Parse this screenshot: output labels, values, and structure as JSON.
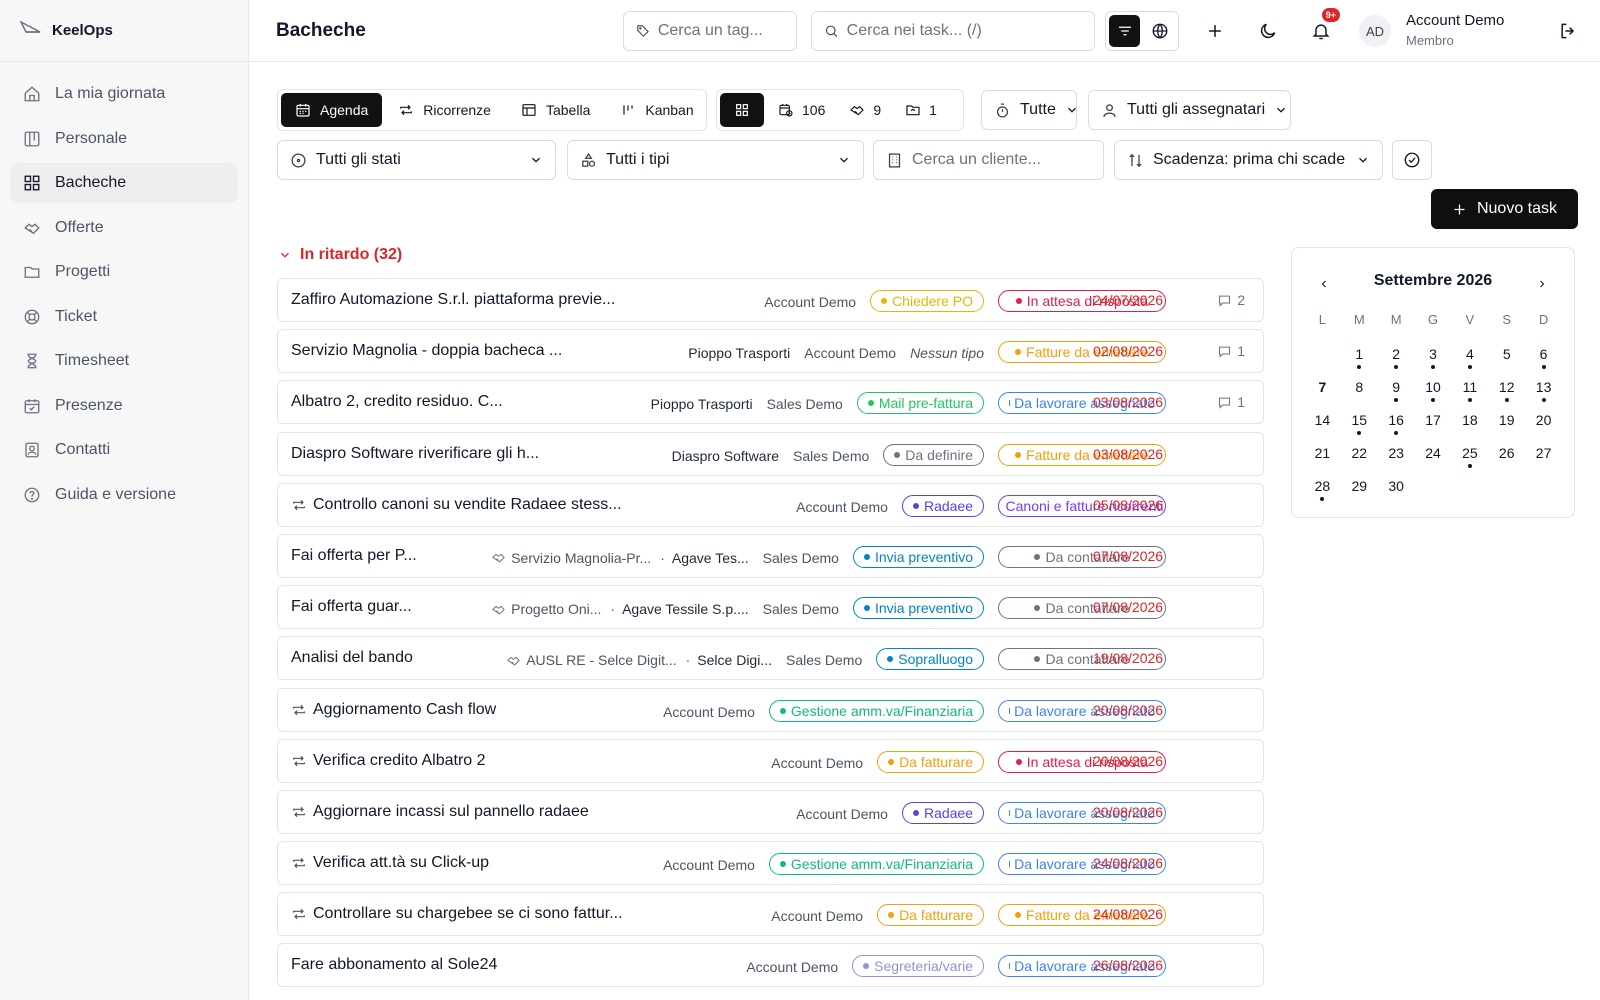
{
  "app": {
    "name": "KeelOps"
  },
  "sidebar": {
    "items": [
      {
        "label": "La mia giornata",
        "icon": "home-icon"
      },
      {
        "label": "Personale",
        "icon": "board-icon"
      },
      {
        "label": "Bacheche",
        "icon": "grid-icon",
        "active": true
      },
      {
        "label": "Offerte",
        "icon": "handshake-icon"
      },
      {
        "label": "Progetti",
        "icon": "folder-icon"
      },
      {
        "label": "Ticket",
        "icon": "lifebuoy-icon"
      },
      {
        "label": "Timesheet",
        "icon": "hourglass-icon"
      },
      {
        "label": "Presenze",
        "icon": "calendar-check-icon"
      },
      {
        "label": "Contatti",
        "icon": "contact-icon"
      },
      {
        "label": "Guida e versione",
        "icon": "help-icon"
      }
    ]
  },
  "header": {
    "title": "Bacheche",
    "tag_search_placeholder": "Cerca un tag...",
    "task_search_placeholder": "Cerca nei task... (/)",
    "notif_badge": "9+",
    "avatar_initials": "AD",
    "user_name": "Account Demo",
    "user_role": "Membro"
  },
  "toolbar": {
    "views": [
      "Agenda",
      "Ricorrenze",
      "Tabella",
      "Kanban"
    ],
    "counts": {
      "tasks": "106",
      "offers": "9",
      "projects": "1"
    },
    "period": "Tutte",
    "assignees": "Tutti gli assegnatari",
    "status": "Tutti gli stati",
    "types": "Tutti i tipi",
    "client_placeholder": "Cerca un cliente...",
    "sort": "Scadenza: prima chi scade",
    "new_task": "Nuovo task"
  },
  "section": {
    "title": "In ritardo (32)"
  },
  "colors": {
    "overdue": "#dc2626",
    "yellow": "#eab308",
    "pink": "#e11d48",
    "orange": "#f59e0b",
    "green": "#22c55e",
    "blue": "#3b82f6",
    "gray": "#6b7280",
    "indigo": "#4f46e5",
    "violet": "#7c3aed",
    "cyan": "#0284c7",
    "emerald": "#10b981",
    "lavender": "#8b93dd"
  },
  "tasks": [
    {
      "recurring": false,
      "title": "Zaffiro Automazione S.r.l. piattaforma previe...",
      "client": "",
      "assignee": "Account Demo",
      "type": "Chiedere PO",
      "type_color": "yellow",
      "status": "In attesa di risposta",
      "status_color": "pink",
      "date": "24/07/2026",
      "comments": "2"
    },
    {
      "recurring": false,
      "title": "Servizio Magnolia - doppia bacheca ...",
      "client": "Pioppo Trasporti",
      "assignee": "Account Demo",
      "no_type": "Nessun tipo",
      "status": "Fatture da emettere",
      "status_color": "orange",
      "date": "02/08/2026",
      "comments": "1"
    },
    {
      "recurring": false,
      "title": "Albatro 2, credito residuo. C...",
      "client": "Pioppo Trasporti",
      "assignee": "Sales Demo",
      "type": "Mail pre-fattura",
      "type_color": "green",
      "status": "Da lavorare assegnato",
      "status_color": "blue",
      "date": "03/08/2026",
      "comments": "1"
    },
    {
      "recurring": false,
      "title": "Diaspro Software riverificare gli h...",
      "client": "Diaspro Software",
      "assignee": "Sales Demo",
      "type": "Da definire",
      "type_color": "gray",
      "status": "Fatture da emettere",
      "status_color": "orange",
      "date": "03/08/2026"
    },
    {
      "recurring": true,
      "title": "Controllo canoni su vendite Radaee stess...",
      "client": "",
      "assignee": "Account Demo",
      "type": "Radaee",
      "type_color": "indigo",
      "status": "Canoni e fatture ricorrenti",
      "status_color": "violet",
      "date": "05/08/2026"
    },
    {
      "recurring": false,
      "title": "Fai offerta per P...",
      "offer": "Servizio Magnolia-Pr...",
      "client_b": "Agave Tes...",
      "assignee": "Sales Demo",
      "type": "Invia preventivo",
      "type_color": "cyan",
      "status": "Da contattare",
      "status_color": "gray",
      "date": "07/08/2026"
    },
    {
      "recurring": false,
      "title": "Fai offerta guar...",
      "offer": "Progetto Oni...",
      "client_b": "Agave Tessile S.p....",
      "assignee": "Sales Demo",
      "type": "Invia preventivo",
      "type_color": "cyan",
      "status": "Da contattare",
      "status_color": "gray",
      "date": "07/08/2026"
    },
    {
      "recurring": false,
      "title": "Analisi del bando",
      "offer": "AUSL RE - Selce Digit...",
      "client_b": "Selce Digi...",
      "assignee": "Sales Demo",
      "type": "Sopralluogo",
      "type_color": "cyan",
      "status": "Da contattare",
      "status_color": "gray",
      "date": "19/08/2026"
    },
    {
      "recurring": true,
      "title": "Aggiornamento Cash flow",
      "client": "",
      "assignee": "Account Demo",
      "type": "Gestione amm.va/Finanziaria",
      "type_color": "emerald",
      "status": "Da lavorare assegnato",
      "status_color": "blue",
      "date": "20/08/2026"
    },
    {
      "recurring": true,
      "title": "Verifica credito Albatro 2",
      "client": "",
      "assignee": "Account Demo",
      "type": "Da fatturare",
      "type_color": "orange",
      "status": "In attesa di risposta",
      "status_color": "pink",
      "date": "20/08/2026"
    },
    {
      "recurring": true,
      "title": "Aggiornare incassi sul pannello radaee",
      "client": "",
      "assignee": "Account Demo",
      "type": "Radaee",
      "type_color": "indigo",
      "status": "Da lavorare assegnato",
      "status_color": "blue",
      "date": "20/08/2026"
    },
    {
      "recurring": true,
      "title": "Verifica att.tà su Click-up",
      "client": "",
      "assignee": "Account Demo",
      "type": "Gestione amm.va/Finanziaria",
      "type_color": "emerald",
      "status": "Da lavorare assegnato",
      "status_color": "blue",
      "date": "24/08/2026"
    },
    {
      "recurring": true,
      "title": "Controllare su chargebee se ci sono fattur...",
      "client": "",
      "assignee": "Account Demo",
      "type": "Da fatturare",
      "type_color": "orange",
      "status": "Fatture da emettere",
      "status_color": "orange",
      "date": "24/08/2026"
    },
    {
      "recurring": false,
      "title": "Fare abbonamento al Sole24",
      "client": "",
      "assignee": "Account Demo",
      "type": "Segreteria/varie",
      "type_color": "lavender",
      "status": "Da lavorare assegnato",
      "status_color": "blue",
      "date": "26/08/2026"
    }
  ],
  "calendar": {
    "month": "Settembre 2026",
    "weekdays": [
      "L",
      "M",
      "M",
      "G",
      "V",
      "S",
      "D"
    ],
    "first_offset": 1,
    "days_in_month": 30,
    "today": 7,
    "dots": [
      1,
      2,
      3,
      4,
      6,
      9,
      10,
      11,
      12,
      13,
      15,
      16,
      25,
      28
    ]
  }
}
